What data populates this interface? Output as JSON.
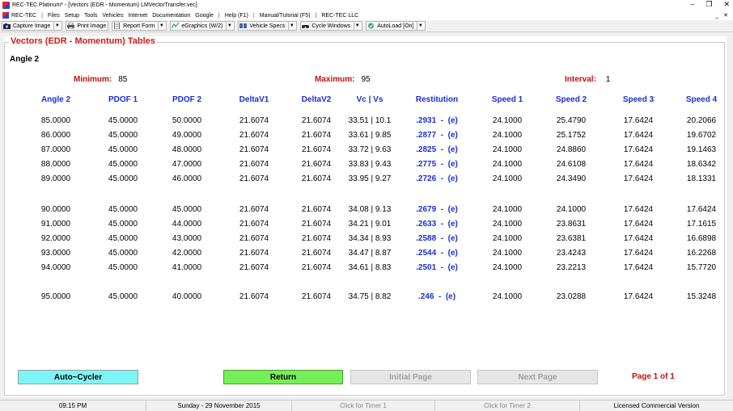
{
  "window": {
    "title": "REC-TEC Platinum* - [Vectors (EDR - Momentum)  LMVectorTransfer.vec]",
    "controls": [
      "–",
      "❐",
      "✕"
    ]
  },
  "menu": {
    "items": [
      "REC-TEC",
      "Files",
      "Setup",
      "Tools",
      "Vehicles",
      "Internet",
      "Documentation",
      "Google",
      "Help (F1)",
      "Manual/Tutorial (F5)",
      "REC-TEC LLC"
    ],
    "right": "_ ✕"
  },
  "toolbar": {
    "buttons": [
      {
        "label": "Capture Image",
        "icon": "camera-icon"
      },
      {
        "label": "Print Image",
        "icon": "printer-icon"
      },
      {
        "label": "Report Form",
        "icon": "document-icon"
      },
      {
        "label": "eGraphics (W/2)",
        "icon": "graphics-icon"
      },
      {
        "label": "Vehicle Specs",
        "icon": "specs-icon"
      },
      {
        "label": "Cycle Windows",
        "icon": "binoculars-icon"
      },
      {
        "label": "AutoLoad [On]",
        "icon": "autoload-icon"
      }
    ]
  },
  "panel": {
    "legend": "Vectors (EDR - Momentum) Tables",
    "angle_label": "Angle 2",
    "minimum_label": "Minimum:",
    "minimum_value": "85",
    "maximum_label": "Maximum:",
    "maximum_value": "95",
    "interval_label": "Interval:",
    "interval_value": "1"
  },
  "table": {
    "headers": [
      "Angle 2",
      "PDOF 1",
      "PDOF 2",
      "DeltaV1",
      "DeltaV2",
      "Vc | Vs",
      "Restitution",
      "Speed 1",
      "Speed 2",
      "Speed 3",
      "Speed 4"
    ],
    "rows": [
      [
        "85.0000",
        "45.0000",
        "50.0000",
        "21.6074",
        "21.6074",
        "33.51 | 10.1",
        ".2931  -  (e)",
        "24.1000",
        "25.4790",
        "17.6424",
        "20.2066"
      ],
      [
        "86.0000",
        "45.0000",
        "49.0000",
        "21.6074",
        "21.6074",
        "33.61 | 9.85",
        ".2877  -  (e)",
        "24.1000",
        "25.1752",
        "17.6424",
        "19.6702"
      ],
      [
        "87.0000",
        "45.0000",
        "48.0000",
        "21.6074",
        "21.6074",
        "33.72 | 9.63",
        ".2825  -  (e)",
        "24.1000",
        "24.8860",
        "17.6424",
        "19.1463"
      ],
      [
        "88.0000",
        "45.0000",
        "47.0000",
        "21.6074",
        "21.6074",
        "33.83 | 9.43",
        ".2775  -  (e)",
        "24.1000",
        "24.6108",
        "17.6424",
        "18.6342"
      ],
      [
        "89.0000",
        "45.0000",
        "46.0000",
        "21.6074",
        "21.6074",
        "33.95 | 9.27",
        ".2726  -  (e)",
        "24.1000",
        "24.3490",
        "17.6424",
        "18.1331"
      ],
      [
        "90.0000",
        "45.0000",
        "45.0000",
        "21.6074",
        "21.6074",
        "34.08 | 9.13",
        ".2679  -  (e)",
        "24.1000",
        "24.1000",
        "17.6424",
        "17.6424"
      ],
      [
        "91.0000",
        "45.0000",
        "44.0000",
        "21.6074",
        "21.6074",
        "34.21 | 9.01",
        ".2633  -  (e)",
        "24.1000",
        "23.8631",
        "17.6424",
        "17.1615"
      ],
      [
        "92.0000",
        "45.0000",
        "43.0000",
        "21.6074",
        "21.6074",
        "34.34 | 8.93",
        ".2588  -  (e)",
        "24.1000",
        "23.6381",
        "17.6424",
        "16.6898"
      ],
      [
        "93.0000",
        "45.0000",
        "42.0000",
        "21.6074",
        "21.6074",
        "34.47 | 8.87",
        ".2544  -  (e)",
        "24.1000",
        "23.4243",
        "17.6424",
        "16.2268"
      ],
      [
        "94.0000",
        "45.0000",
        "41.0000",
        "21.6074",
        "21.6074",
        "34.61 | 8.83",
        ".2501  -  (e)",
        "24.1000",
        "23.2213",
        "17.6424",
        "15.7720"
      ],
      [
        "95.0000",
        "45.0000",
        "40.0000",
        "21.6074",
        "21.6074",
        "34.75 | 8.82",
        ".246  -  (e)",
        "24.1000",
        "23.0288",
        "17.6424",
        "15.3248"
      ]
    ]
  },
  "buttons": {
    "auto_cycler": "Auto~Cycler",
    "return": "Return",
    "initial_page": "Initial Page",
    "next_page": "Next Page",
    "page_indicator": "Page  1 of  1"
  },
  "status": {
    "time": "09:15 PM",
    "date": "Sunday  -  29 November 2015",
    "timer1": "Click for Timer 1",
    "timer2": "Click for Timer 2",
    "license": "Licensed Commercial Version"
  },
  "colors": {
    "legend_red": "#d01818",
    "header_blue": "#1a2fd0",
    "auto_cyan": "#7ff4f4",
    "return_green": "#76ee58"
  }
}
